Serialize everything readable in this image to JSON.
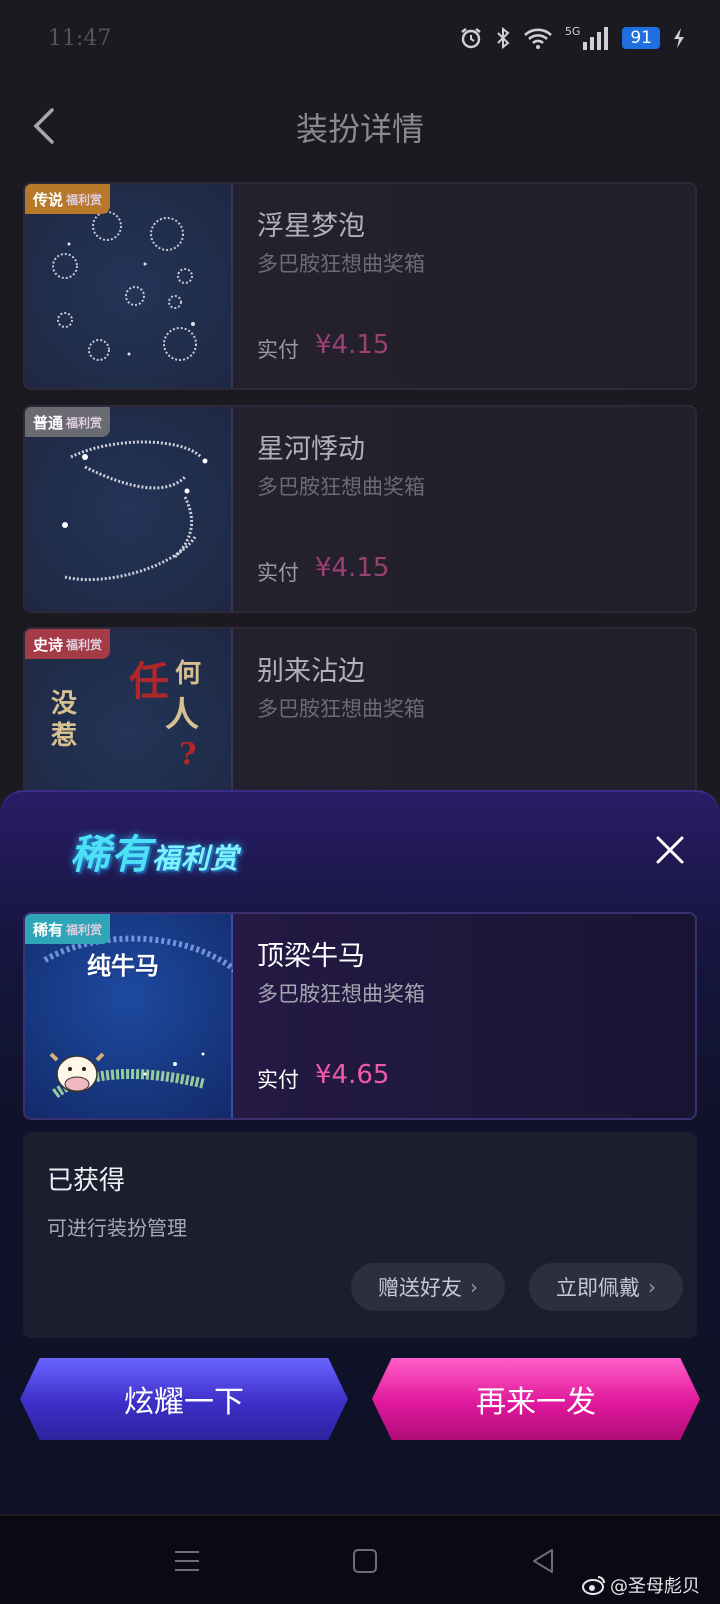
{
  "status_bar": {
    "time": "11:47",
    "network": "5G",
    "battery": "91"
  },
  "header": {
    "title": "装扮详情"
  },
  "list": [
    {
      "tag": "传说",
      "tag_suffix": "福利赏",
      "tag_color": "#b8782a",
      "name": "浮星梦泡",
      "source": "多巴胺狂想曲奖箱",
      "pay_label": "实付",
      "price": "¥4.15"
    },
    {
      "tag": "普通",
      "tag_suffix": "福利赏",
      "tag_color": "#6a6b72",
      "name": "星河悸动",
      "source": "多巴胺狂想曲奖箱",
      "pay_label": "实付",
      "price": "¥4.15"
    },
    {
      "tag": "史诗",
      "tag_suffix": "福利赏",
      "tag_color": "#a63b48",
      "name": "别来沾边",
      "source": "多巴胺狂想曲奖箱",
      "thumb_text": [
        "没",
        "惹",
        "任",
        "何",
        "人",
        "?"
      ]
    }
  ],
  "modal": {
    "title": "稀有",
    "title_suffix": "福利赏",
    "item": {
      "tag": "稀有",
      "tag_suffix": "福利赏",
      "tag_color": "#2fa6b8",
      "thumb_text": "纯牛马",
      "name": "顶梁牛马",
      "source": "多巴胺狂想曲奖箱",
      "pay_label": "实付",
      "price": "¥4.65"
    },
    "obtained": {
      "title": "已获得",
      "subtitle": "可进行装扮管理",
      "gift_label": "赠送好友",
      "wear_label": "立即佩戴"
    },
    "show_off_label": "炫耀一下",
    "again_label": "再来一发"
  },
  "watermark": "@圣母彪贝"
}
